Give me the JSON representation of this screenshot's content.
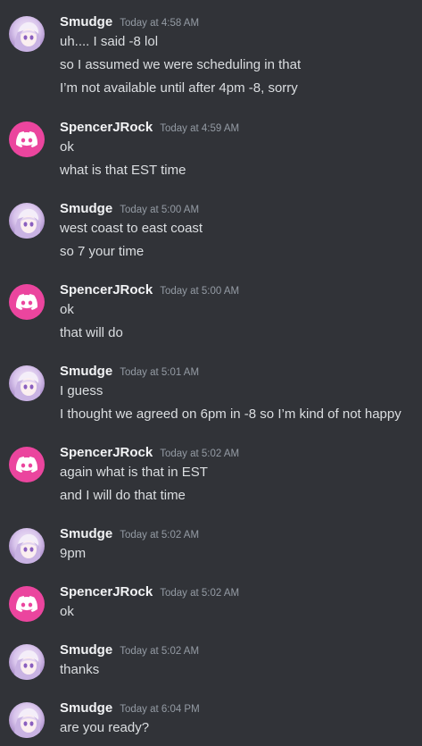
{
  "messages": [
    {
      "author": "Smudge",
      "time": "Today at 4:58 AM",
      "avatar": "anime-girl-avatar",
      "lines": [
        "uh.... I said -8 lol",
        "so I assumed we were scheduling in that",
        "I’m not available until after 4pm -8, sorry"
      ]
    },
    {
      "author": "SpencerJRock",
      "time": "Today at 4:59 AM",
      "avatar": "discord-default-avatar",
      "lines": [
        "ok",
        "what is that EST time"
      ]
    },
    {
      "author": "Smudge",
      "time": "Today at 5:00 AM",
      "avatar": "anime-girl-avatar",
      "lines": [
        "west coast to east coast",
        "so 7 your time"
      ]
    },
    {
      "author": "SpencerJRock",
      "time": "Today at 5:00 AM",
      "avatar": "discord-default-avatar",
      "lines": [
        "ok",
        "that will do"
      ]
    },
    {
      "author": "Smudge",
      "time": "Today at 5:01 AM",
      "avatar": "anime-girl-avatar",
      "lines": [
        "I guess",
        "I thought we agreed on 6pm in -8 so I’m kind of not happy"
      ]
    },
    {
      "author": "SpencerJRock",
      "time": "Today at 5:02 AM",
      "avatar": "discord-default-avatar",
      "lines": [
        "again what is that in EST",
        "and I will do that time"
      ]
    },
    {
      "author": "Smudge",
      "time": "Today at 5:02 AM",
      "avatar": "anime-girl-avatar",
      "lines": [
        "9pm"
      ]
    },
    {
      "author": "SpencerJRock",
      "time": "Today at 5:02 AM",
      "avatar": "discord-default-avatar",
      "lines": [
        "ok"
      ]
    },
    {
      "author": "Smudge",
      "time": "Today at 5:02 AM",
      "avatar": "anime-girl-avatar",
      "lines": [
        "thanks"
      ]
    },
    {
      "author": "Smudge",
      "time": "Today at 6:04 PM",
      "avatar": "anime-girl-avatar",
      "lines": [
        "are you ready?"
      ]
    }
  ],
  "colors": {
    "background": "#313338",
    "discord_avatar": "#eb459e",
    "author": "#f2f3f5",
    "timestamp": "#949ba4",
    "text": "#dbdee1"
  }
}
